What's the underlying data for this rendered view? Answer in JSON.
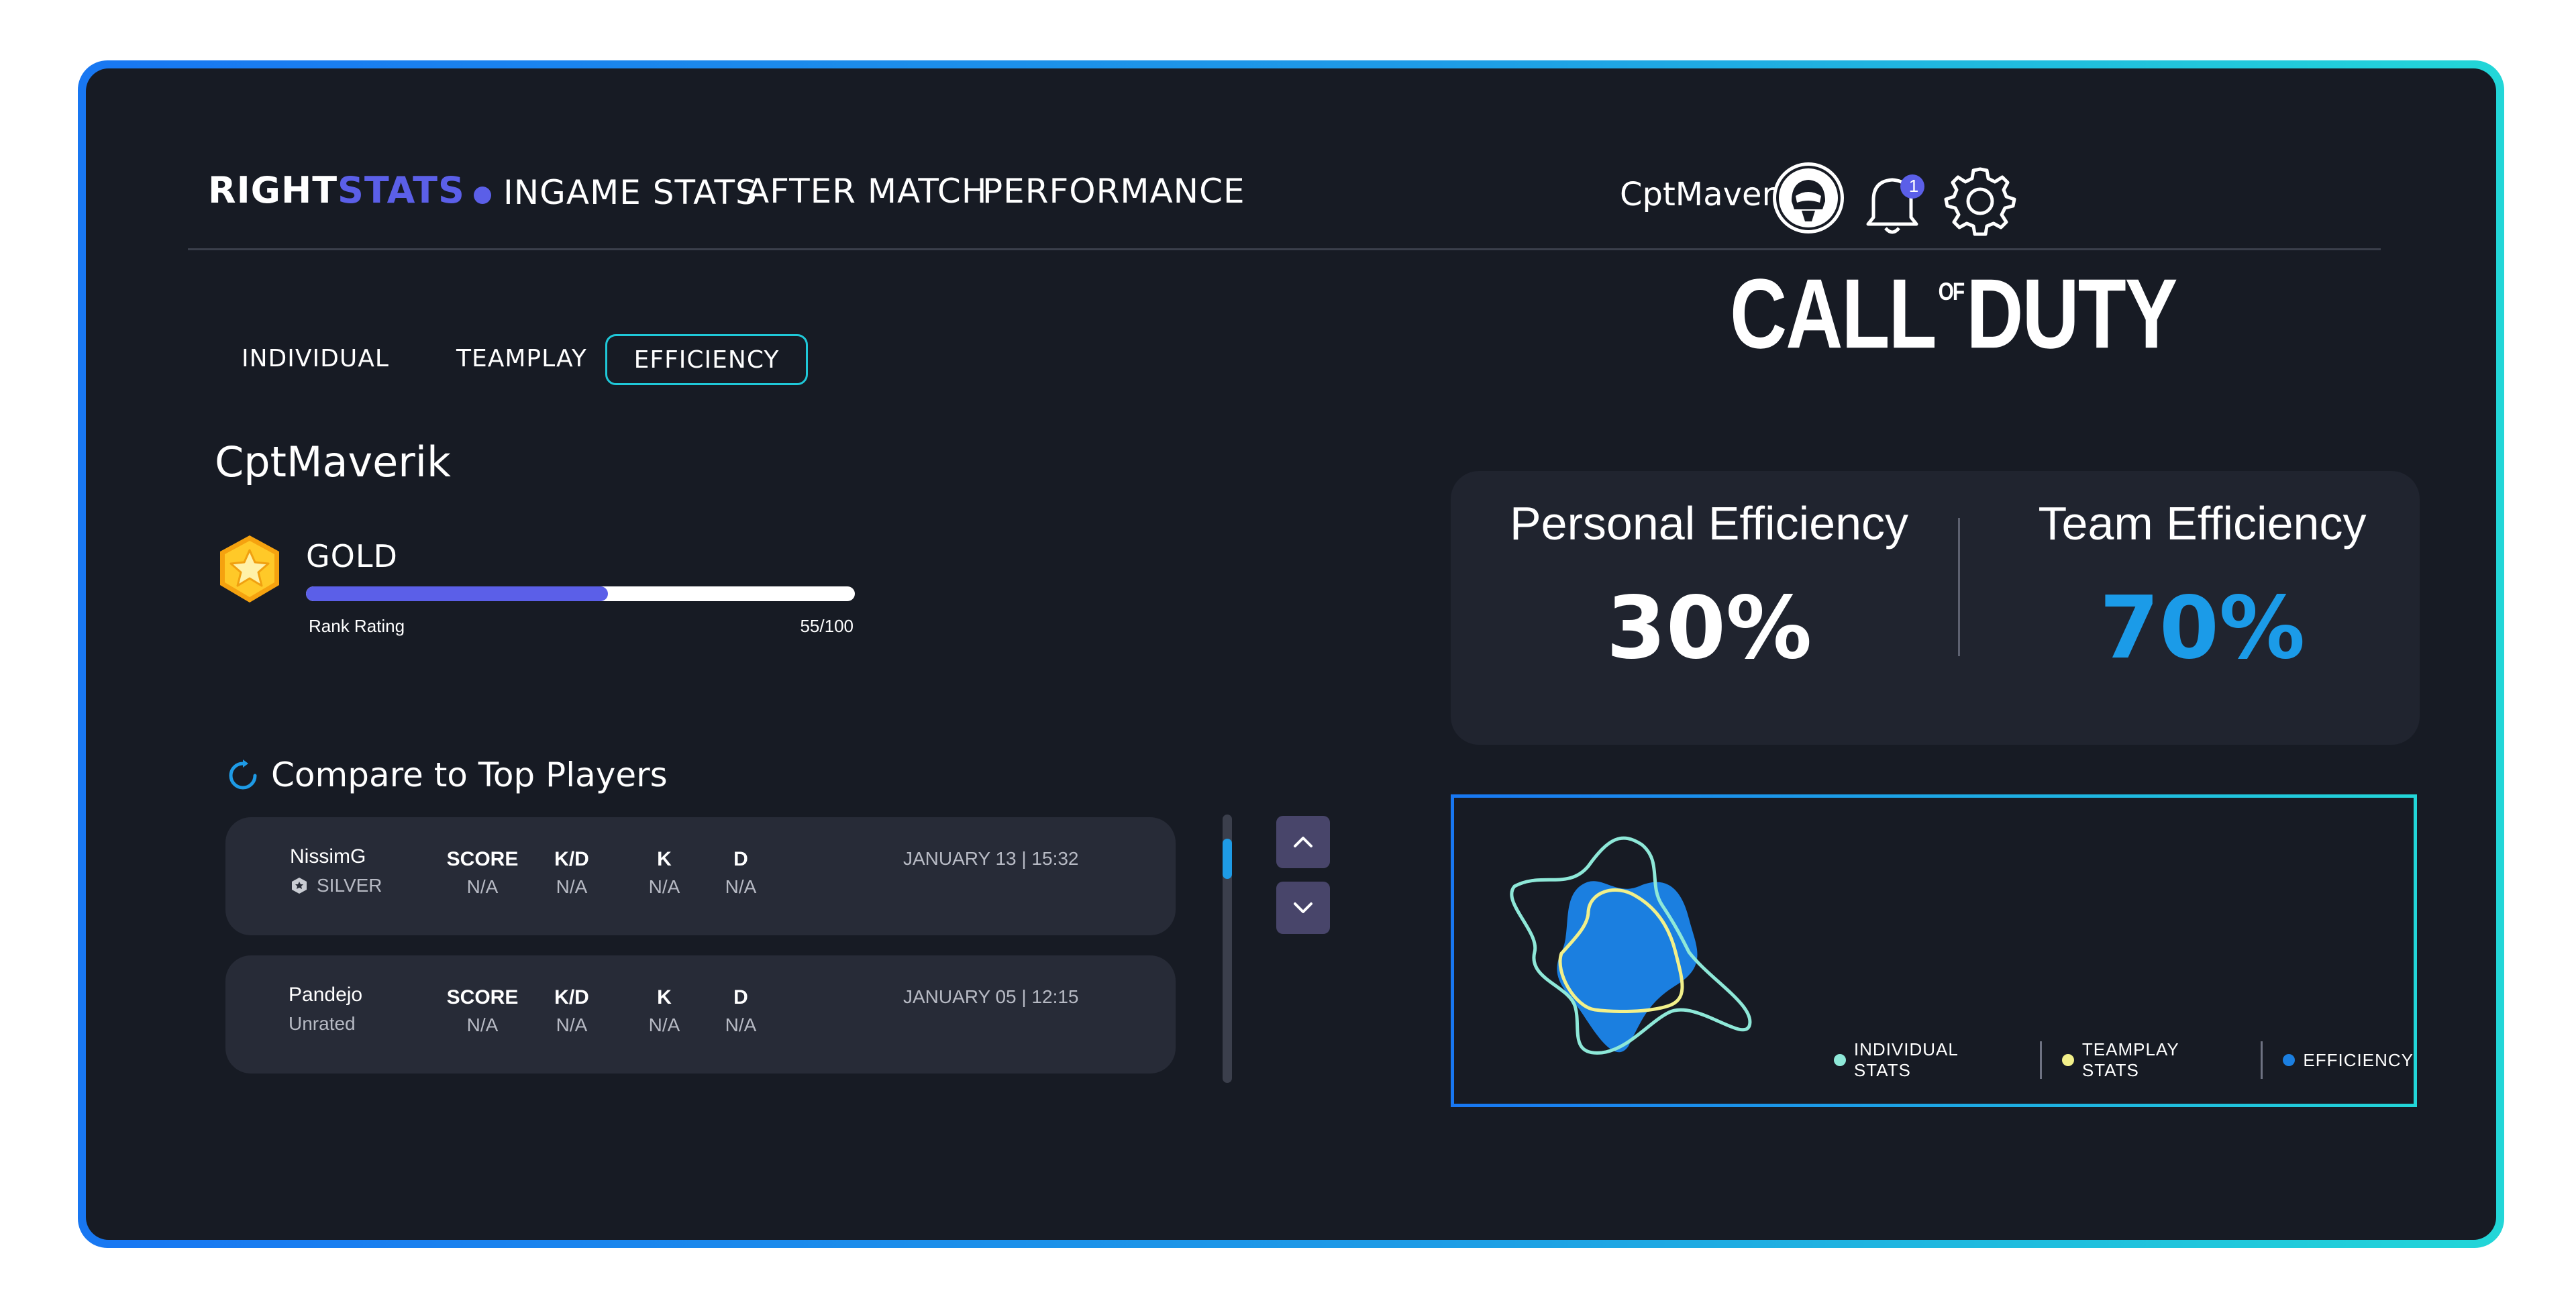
{
  "brand": {
    "part1": "RIGHT",
    "part2": "STATS"
  },
  "nav": {
    "items": [
      "INGAME STATS",
      "AFTER MATCH",
      "PERFORMANCE"
    ]
  },
  "user": {
    "name": "CptMaverik",
    "notifications": "1"
  },
  "subtabs": [
    "INDIVIDUAL",
    "TEAMPLAY",
    "EFFICIENCY"
  ],
  "game_logo": {
    "text": "CALL OF DUTY",
    "left": "CALL",
    "of": "OF",
    "right": "DUTY"
  },
  "profile": {
    "name": "CptMaverik",
    "rank": "GOLD",
    "rating_label": "Rank Rating",
    "rating_value": "55/100",
    "rating_progress": 0.55
  },
  "efficiency": {
    "personal_label": "Personal Efficiency",
    "personal_value": "30%",
    "team_label": "Team Efficiency",
    "team_value": "70%"
  },
  "compare": {
    "title": "Compare to Top Players",
    "columns": [
      "SCORE",
      "K/D",
      "K",
      "D"
    ],
    "rows": [
      {
        "name": "NissimG",
        "rank": "SILVER",
        "values": [
          "N/A",
          "N/A",
          "N/A",
          "N/A"
        ],
        "date": "JANUARY 13 | 15:32"
      },
      {
        "name": "Pandejo",
        "rank": "Unrated",
        "values": [
          "N/A",
          "N/A",
          "N/A",
          "N/A"
        ],
        "date": "JANUARY 05 | 12:15"
      }
    ]
  },
  "legend": [
    {
      "label": "INDIVIDUAL STATS",
      "color": "#8ee8d8"
    },
    {
      "label": "TEAMPLAY STATS",
      "color": "#f2f08a"
    },
    {
      "label": "EFFICIENCY",
      "color": "#1b7fe0"
    }
  ],
  "colors": {
    "accent": "#5b5fe8",
    "cyan": "#1fc8d8",
    "team_value": "#1b9be8"
  }
}
